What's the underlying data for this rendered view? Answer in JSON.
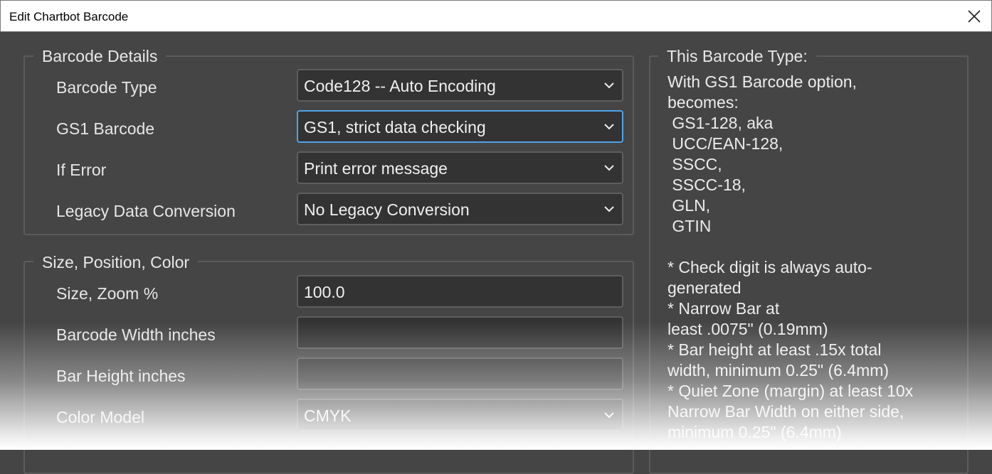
{
  "window": {
    "title": "Edit Chartbot Barcode"
  },
  "barcode_details": {
    "legend": "Barcode Details",
    "barcode_type": {
      "label": "Barcode Type",
      "value": "Code128 -- Auto Encoding"
    },
    "gs1_barcode": {
      "label": "GS1 Barcode",
      "value": "GS1, strict data checking"
    },
    "if_error": {
      "label": "If Error",
      "value": "Print error message"
    },
    "legacy": {
      "label": "Legacy Data Conversion",
      "value": "No Legacy Conversion"
    }
  },
  "size_position_color": {
    "legend": "Size, Position, Color",
    "zoom": {
      "label": "Size, Zoom %",
      "value": "100.0"
    },
    "width": {
      "label": "Barcode Width inches",
      "value": ""
    },
    "bar_height": {
      "label": "Bar Height inches",
      "value": ""
    },
    "color_model": {
      "label": "Color Model",
      "value": "CMYK"
    }
  },
  "info": {
    "legend": "This Barcode Type:",
    "text": "With GS1 Barcode option,\nbecomes:\n GS1-128, aka\n UCC/EAN-128,\n SSCC,\n SSCC-18,\n GLN,\n GTIN\n\n* Check digit is always auto-\ngenerated\n* Narrow Bar at\nleast .0075\" (0.19mm)\n* Bar height at least .15x total\nwidth, minimum 0.25\" (6.4mm)\n* Quiet Zone (margin) at least 10x\nNarrow Bar Width on either side,\nminimum 0.25\" (6.4mm)"
  },
  "colors": {
    "focus_border": "#4fa3e6",
    "background": "#454545",
    "field_background": "#333333"
  },
  "icons": {
    "close": "close-icon",
    "dropdown": "chevron-down-icon"
  }
}
